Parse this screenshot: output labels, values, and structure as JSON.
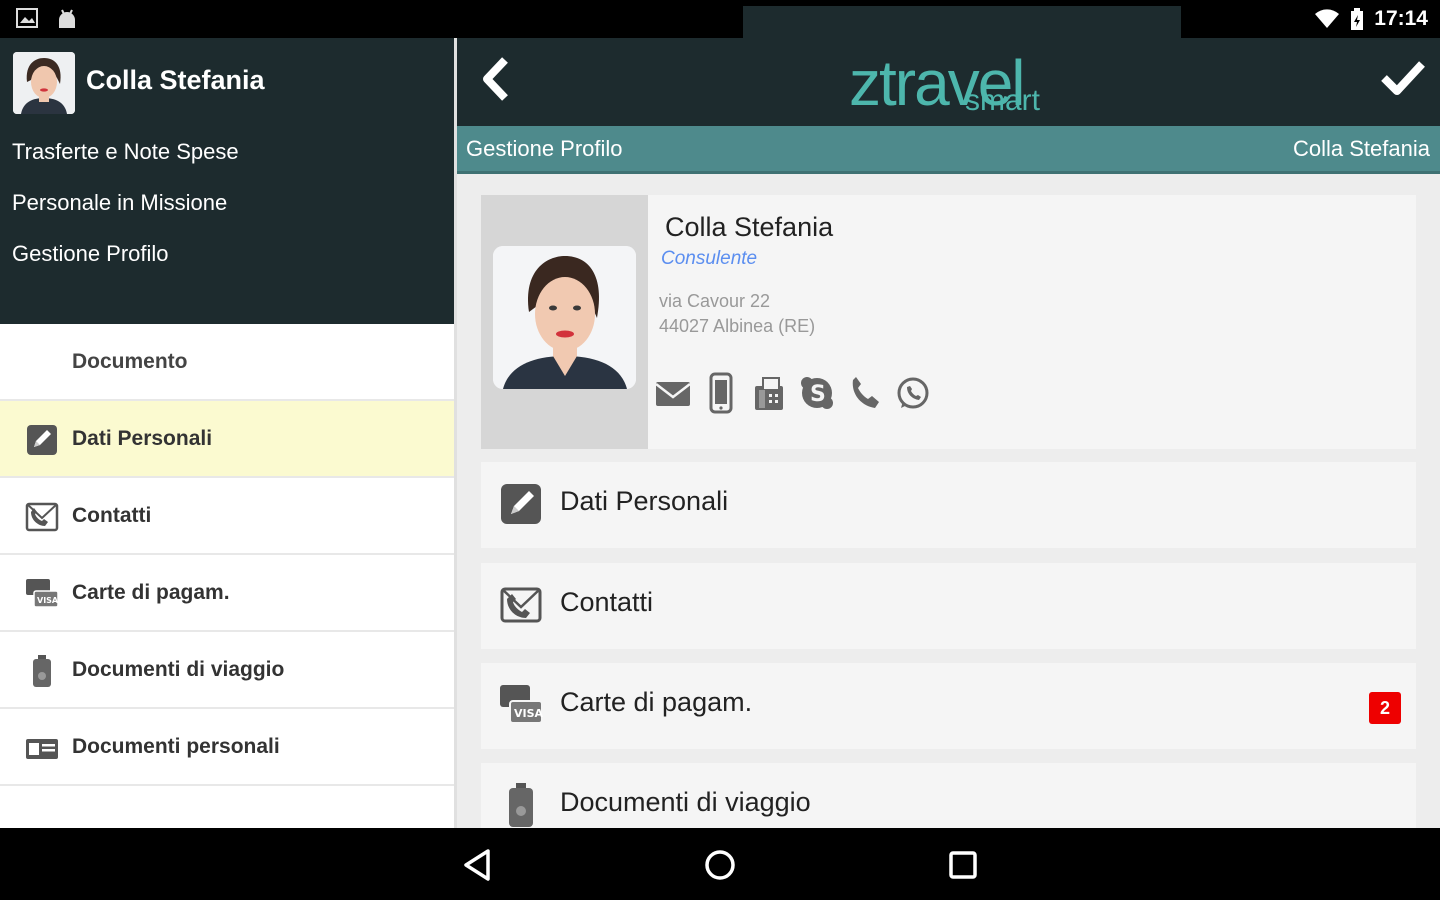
{
  "status_bar": {
    "time": "17:14"
  },
  "drawer": {
    "user_name": "Colla Stefania",
    "menu": [
      {
        "label": "Trasferte e Note Spese"
      },
      {
        "label": "Personale in Missione"
      },
      {
        "label": "Gestione Profilo"
      }
    ],
    "items": [
      {
        "label": "Documento",
        "icon": "none"
      },
      {
        "label": "Dati Personali",
        "icon": "edit-icon"
      },
      {
        "label": "Contatti",
        "icon": "contacts-icon"
      },
      {
        "label": "Carte di pagam.",
        "icon": "payment-card-icon"
      },
      {
        "label": "Documenti di viaggio",
        "icon": "luggage-icon"
      },
      {
        "label": "Documenti personali",
        "icon": "id-card-icon"
      }
    ]
  },
  "header": {
    "logo_main": "ztravel",
    "logo_sub": "smart",
    "subtitle_left": "Gestione Profilo",
    "subtitle_right": "Colla Stefania"
  },
  "profile": {
    "name": "Colla Stefania",
    "role": "Consulente",
    "address_line1": "via Cavour 22",
    "address_line2": "44027 Albinea (RE)",
    "contact_icons": [
      "mail-icon",
      "mobile-icon",
      "fax-icon",
      "skype-icon",
      "phone-icon",
      "whatsapp-icon"
    ]
  },
  "sections": [
    {
      "label": "Dati Personali",
      "icon": "edit-icon"
    },
    {
      "label": "Contatti",
      "icon": "contacts-icon"
    },
    {
      "label": "Carte di pagam.",
      "icon": "payment-card-icon",
      "badge": "2"
    },
    {
      "label": "Documenti di viaggio",
      "icon": "luggage-icon"
    }
  ],
  "colors": {
    "dark_header": "#1d2b2e",
    "teal_bar": "#4e8a8c",
    "logo_teal": "#4db6ac",
    "active_item": "#fbfad0",
    "badge_red": "#ee0000",
    "role_blue": "#5b8ef0"
  }
}
